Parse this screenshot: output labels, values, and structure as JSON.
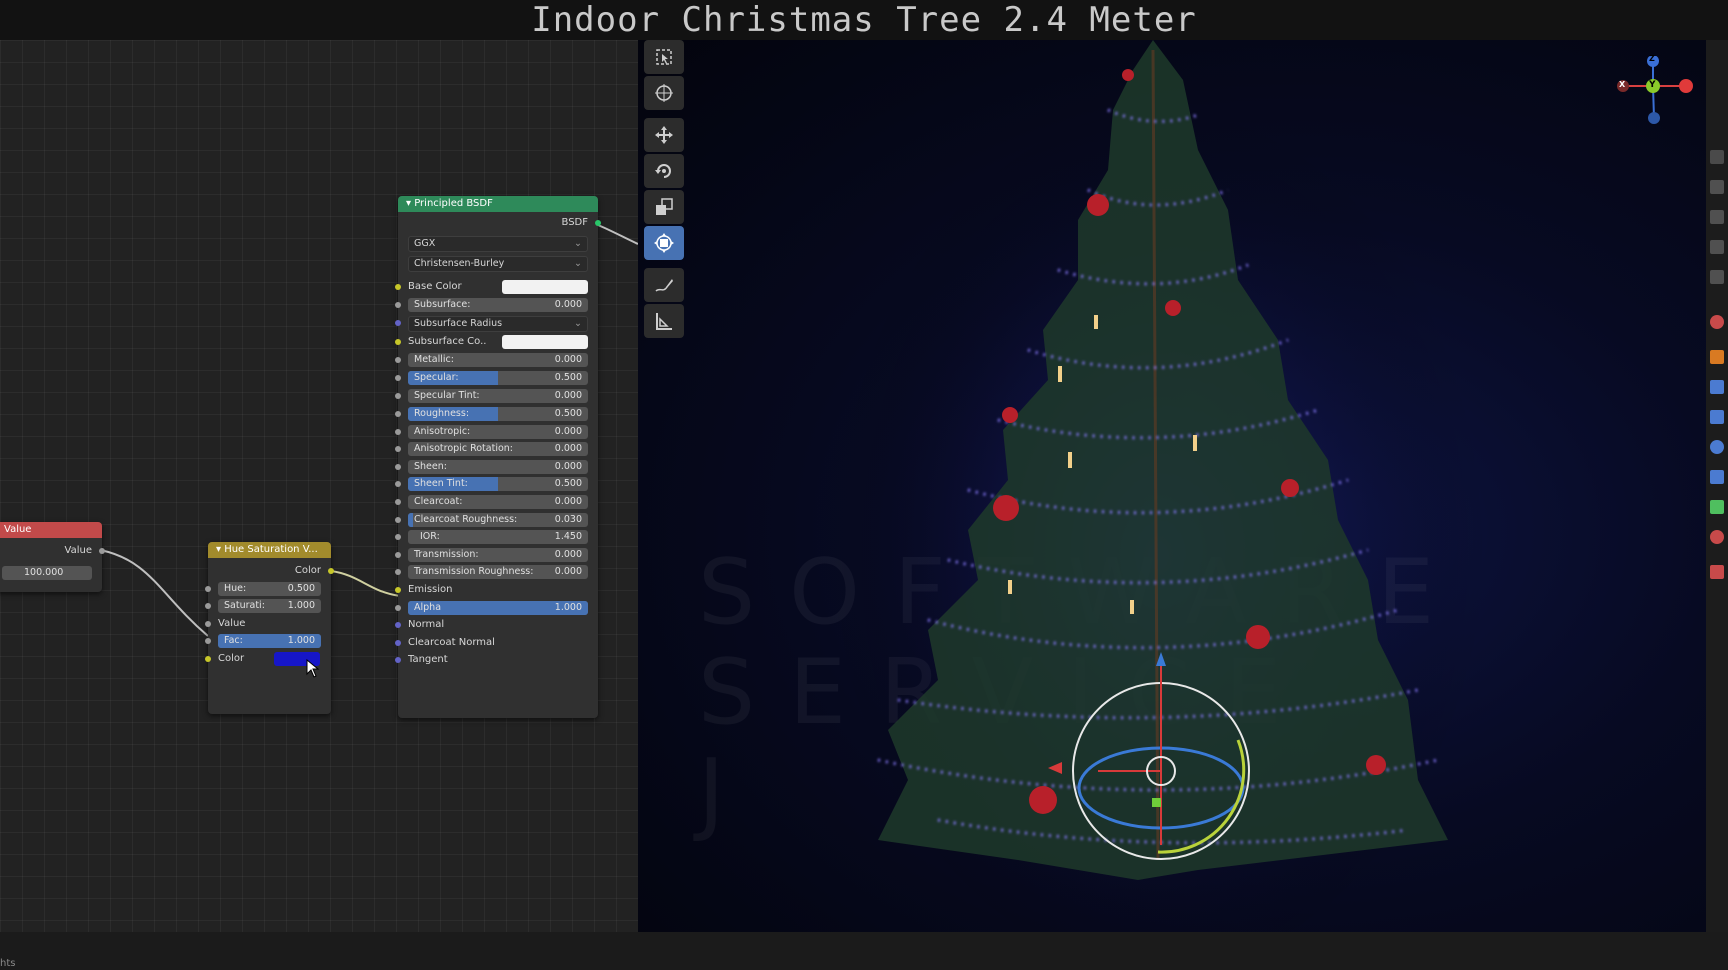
{
  "caption": {
    "title": "Indoor Christmas Tree 2.4 Meter"
  },
  "status": {
    "text": "hts"
  },
  "nodes": {
    "value": {
      "header": "Value",
      "output": "Value",
      "field_value": "100.000",
      "header_color": "#c24a4a"
    },
    "hue_sat": {
      "header": "Hue Saturation V...",
      "output": "Color",
      "header_color": "#a28b2c",
      "hue": {
        "label": "Hue:",
        "value": "0.500"
      },
      "saturation": {
        "label": "Saturati:",
        "value": "1.000"
      },
      "value_label": "Value",
      "fac": {
        "label": "Fac:",
        "value": "1.000"
      },
      "color_label": "Color",
      "color_swatch": "#1616c8"
    },
    "bsdf": {
      "header": "Principled BSDF",
      "header_color": "#2e8a5a",
      "output": "BSDF",
      "distribution": "GGX",
      "subsurface_method": "Christensen-Burley",
      "base_color": {
        "label": "Base Color",
        "swatch": "#f2f2f2"
      },
      "subsurface": {
        "label": "Subsurface:",
        "value": "0.000"
      },
      "subsurface_radius": "Subsurface Radius",
      "subsurface_color": {
        "label": "Subsurface Co..",
        "swatch": "#f2f2f2"
      },
      "metallic": {
        "label": "Metallic:",
        "value": "0.000"
      },
      "specular": {
        "label": "Specular:",
        "value": "0.500",
        "fill": 0.5
      },
      "specular_tint": {
        "label": "Specular Tint:",
        "value": "0.000"
      },
      "roughness": {
        "label": "Roughness:",
        "value": "0.500",
        "fill": 0.5
      },
      "anisotropic": {
        "label": "Anisotropic:",
        "value": "0.000"
      },
      "anisotropic_rotation": {
        "label": "Anisotropic Rotation:",
        "value": "0.000"
      },
      "sheen": {
        "label": "Sheen:",
        "value": "0.000"
      },
      "sheen_tint": {
        "label": "Sheen Tint:",
        "value": "0.500",
        "fill": 0.5
      },
      "clearcoat": {
        "label": "Clearcoat:",
        "value": "0.000"
      },
      "clearcoat_roughness": {
        "label": "Clearcoat Roughness:",
        "value": "0.030"
      },
      "ior": {
        "label": "IOR:",
        "value": "1.450"
      },
      "transmission": {
        "label": "Transmission:",
        "value": "0.000"
      },
      "transmission_roughness": {
        "label": "Transmission Roughness:",
        "value": "0.000"
      },
      "emission": "Emission",
      "alpha": {
        "label": "Alpha",
        "value": "1.000",
        "fill": 1.0
      },
      "normal": "Normal",
      "clearcoat_normal": "Clearcoat Normal",
      "tangent": "Tangent"
    }
  },
  "viewport": {
    "watermark": [
      "SOFTWARE",
      "SERVICE",
      "J"
    ],
    "gizmo_axes": {
      "x": "X",
      "y": "Y",
      "z": "Z"
    }
  },
  "toolbar": {
    "tools": [
      "select-box-icon",
      "cursor-icon",
      "move-icon",
      "rotate-icon",
      "scale-icon",
      "transform-icon",
      "annotate-icon",
      "measure-icon"
    ],
    "active": "transform-icon"
  },
  "colors": {
    "accent": "#4772b3",
    "light_strings": "#6a5cff",
    "ornament": "#b8202a"
  }
}
